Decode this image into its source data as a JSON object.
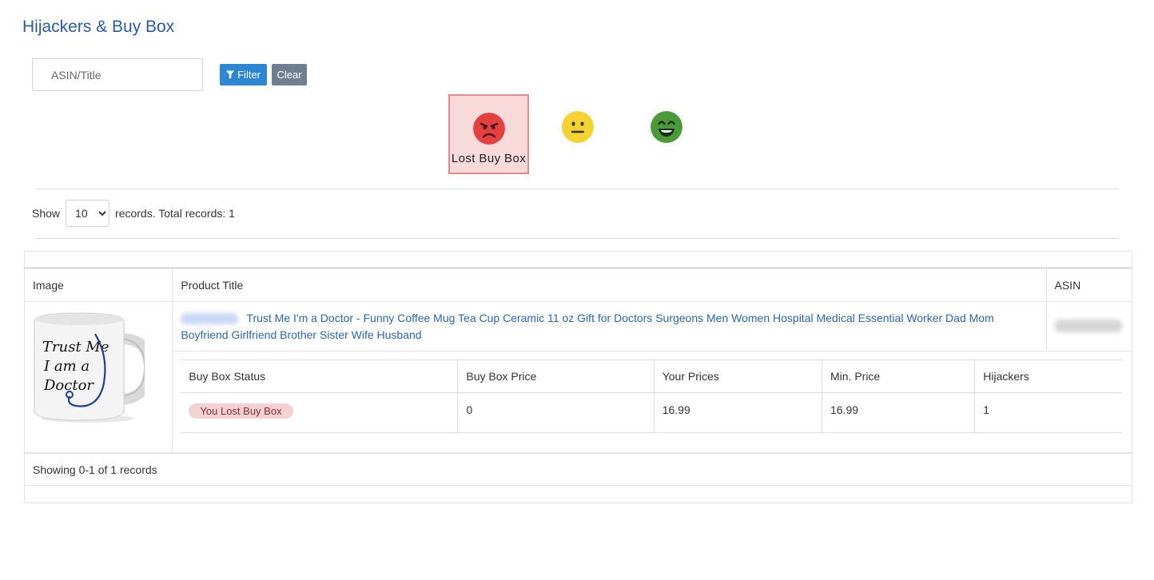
{
  "page": {
    "title": "Hijackers & Buy Box"
  },
  "search": {
    "placeholder": "ASIN/Title",
    "value": ""
  },
  "buttons": {
    "filter_label": "Filter",
    "clear_label": "Clear"
  },
  "status_filters": [
    {
      "label": "Lost Buy Box",
      "face": "angry-face-icon",
      "color": "#e63f3f",
      "active": true
    },
    {
      "label": "",
      "face": "neutral-face-icon",
      "color": "#f3d232",
      "active": false
    },
    {
      "label": "",
      "face": "happy-face-icon",
      "color": "#4b9a3a",
      "active": false
    }
  ],
  "pagination": {
    "show_label": "Show",
    "page_size": "10",
    "page_size_options": [
      "10",
      "25",
      "50",
      "100"
    ],
    "records_label": "records. Total records: 1",
    "summary": "Showing 0-1 of 1 records"
  },
  "table": {
    "headers": {
      "image": "Image",
      "title": "Product Title",
      "asin": "ASIN"
    },
    "rows": [
      {
        "image_text": [
          "Trust Me",
          "I am a",
          "Doctor"
        ],
        "title": "Trust Me I'm a Doctor - Funny Coffee Mug Tea Cup Ceramic 11 oz Gift for Doctors Surgeons Men Women Hospital Medical Essential Worker Dad Mom Boyfriend Girlfriend Brother Sister Wife Husband",
        "buy_box": {
          "headers": [
            "Buy Box Status",
            "Buy Box Price",
            "Your Prices",
            "Min. Price",
            "Hijackers"
          ],
          "status": "You Lost Buy Box",
          "buy_box_price": "0",
          "your_prices": "16.99",
          "min_price": "16.99",
          "hijackers": "1"
        }
      }
    ]
  }
}
